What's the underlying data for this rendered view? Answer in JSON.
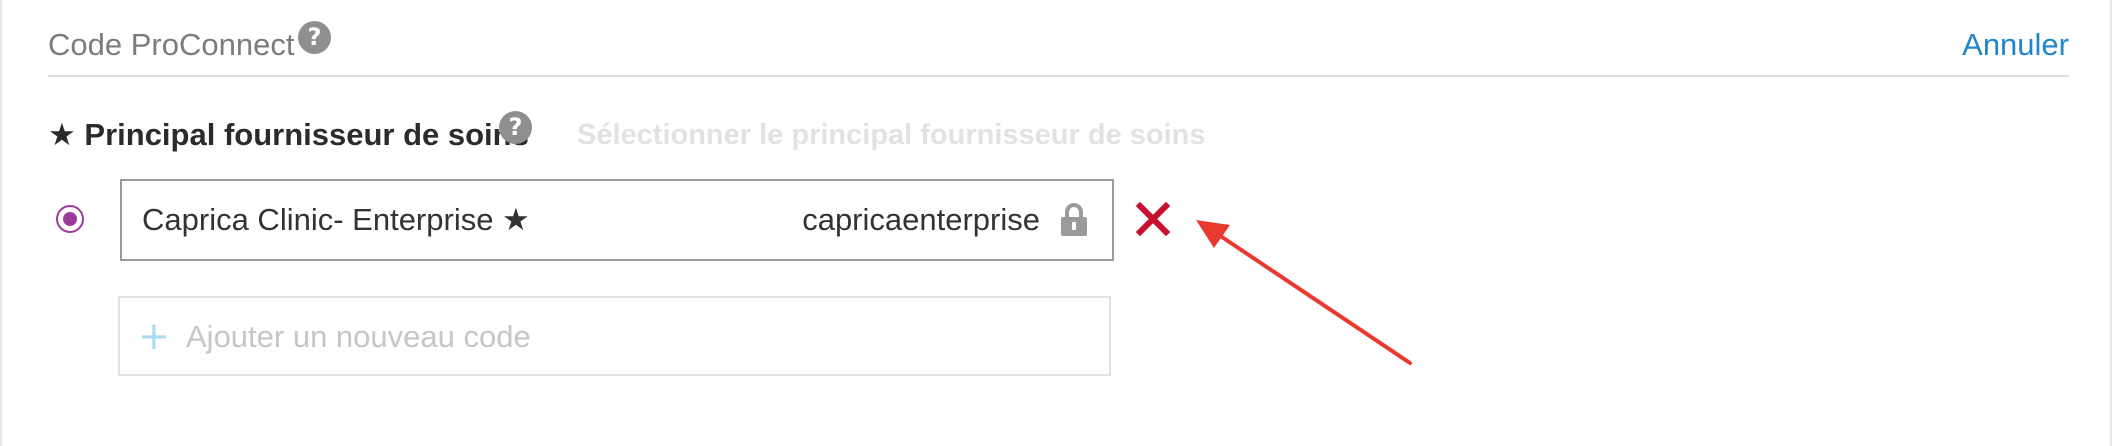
{
  "header": {
    "title": "Code ProConnect",
    "help_icon": "question-circle-icon",
    "cancel_label": "Annuler"
  },
  "section": {
    "title": "★ Principal fournisseur de soins",
    "help_icon": "question-circle-icon",
    "hint": "Sélectionner le principal fournisseur de soins"
  },
  "code_entry": {
    "selected": true,
    "name": "Caprica Clinic- Enterprise ★",
    "code": "capricaenterprise",
    "lock_icon": "lock-icon",
    "remove_icon": "close-x-icon"
  },
  "add_code": {
    "icon": "plus-icon",
    "placeholder": "Ajouter un nouveau code"
  },
  "annotation": {
    "arrow_color": "#e83a2f"
  },
  "colors": {
    "accent_link": "#1f87c7",
    "radio": "#9b3c9b",
    "remove": "#c8102e",
    "plus": "#a8dcf3"
  }
}
